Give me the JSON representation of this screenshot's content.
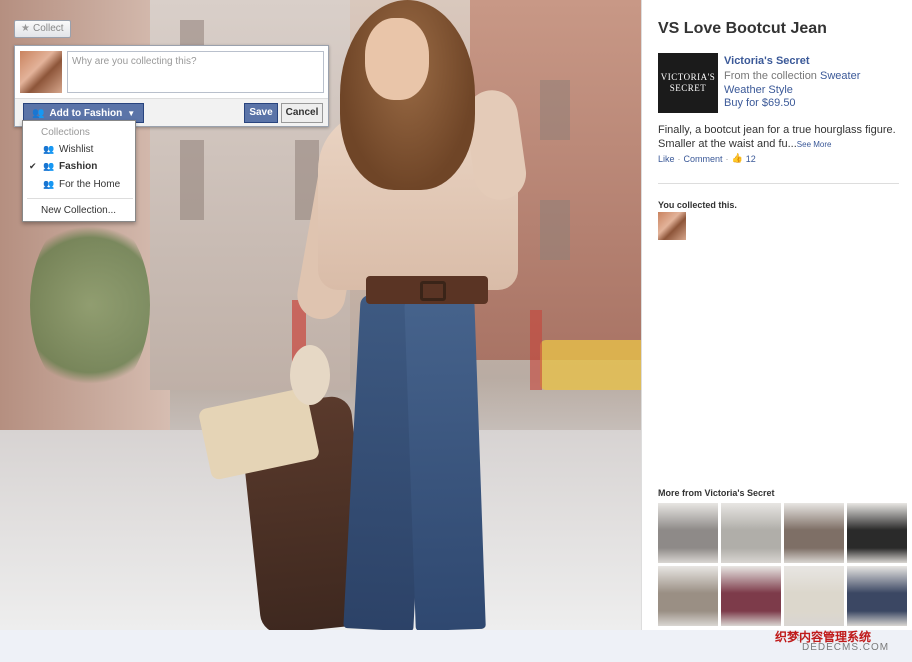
{
  "collect_button": {
    "label": "Collect",
    "icon": "star-icon"
  },
  "collect_panel": {
    "placeholder": "Why are you collecting this?",
    "add_button_label": "Add to Fashion",
    "save_label": "Save",
    "cancel_label": "Cancel"
  },
  "dropdown": {
    "header": "Collections",
    "items": [
      {
        "label": "Wishlist",
        "checked": false
      },
      {
        "label": "Fashion",
        "checked": true
      },
      {
        "label": "For the Home",
        "checked": false
      }
    ],
    "new_label": "New Collection..."
  },
  "product": {
    "title": "VS Love Bootcut Jean",
    "logo_text": "VICTORIA'S SECRET",
    "brand": "Victoria's Secret",
    "from_prefix": "From the collection",
    "collection": "Sweater Weather Style",
    "buy": "Buy for $69.50",
    "description": "Finally, a bootcut jean for a true hourglass figure. Smaller at the waist and fu...",
    "see_more": "See More",
    "like": "Like",
    "comment": "Comment",
    "like_count": "12"
  },
  "you_collected": "You collected this.",
  "more_from": "More from Victoria's Secret",
  "watermark": {
    "line1": "织梦内容管理系统",
    "line2": "DEDECMS.COM",
    "ghost": "Fa"
  },
  "colors": {
    "accent": "#3b5998",
    "button": "#5b74a8",
    "logo_bg": "#1b1b1b"
  },
  "thumbnails": [
    {
      "bg": "#8e8a88"
    },
    {
      "bg": "#b0aea9"
    },
    {
      "bg": "#7e6f66"
    },
    {
      "bg": "#2a2a2a"
    },
    {
      "bg": "#9a8f84"
    },
    {
      "bg": "#7d3b4a"
    },
    {
      "bg": "#dcd7cc"
    },
    {
      "bg": "#3b4763"
    }
  ]
}
